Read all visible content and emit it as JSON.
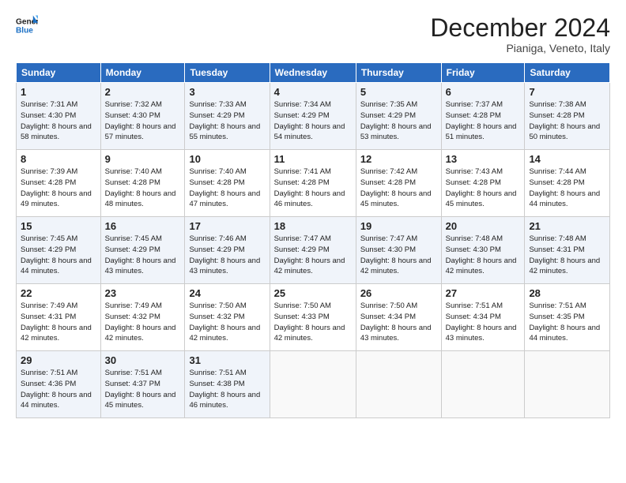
{
  "logo": {
    "line1": "General",
    "line2": "Blue"
  },
  "header": {
    "month": "December 2024",
    "location": "Pianiga, Veneto, Italy"
  },
  "weekdays": [
    "Sunday",
    "Monday",
    "Tuesday",
    "Wednesday",
    "Thursday",
    "Friday",
    "Saturday"
  ],
  "weeks": [
    [
      {
        "day": "1",
        "rise": "7:31 AM",
        "set": "4:30 PM",
        "daylight": "8 hours and 58 minutes."
      },
      {
        "day": "2",
        "rise": "7:32 AM",
        "set": "4:30 PM",
        "daylight": "8 hours and 57 minutes."
      },
      {
        "day": "3",
        "rise": "7:33 AM",
        "set": "4:29 PM",
        "daylight": "8 hours and 55 minutes."
      },
      {
        "day": "4",
        "rise": "7:34 AM",
        "set": "4:29 PM",
        "daylight": "8 hours and 54 minutes."
      },
      {
        "day": "5",
        "rise": "7:35 AM",
        "set": "4:29 PM",
        "daylight": "8 hours and 53 minutes."
      },
      {
        "day": "6",
        "rise": "7:37 AM",
        "set": "4:28 PM",
        "daylight": "8 hours and 51 minutes."
      },
      {
        "day": "7",
        "rise": "7:38 AM",
        "set": "4:28 PM",
        "daylight": "8 hours and 50 minutes."
      }
    ],
    [
      {
        "day": "8",
        "rise": "7:39 AM",
        "set": "4:28 PM",
        "daylight": "8 hours and 49 minutes."
      },
      {
        "day": "9",
        "rise": "7:40 AM",
        "set": "4:28 PM",
        "daylight": "8 hours and 48 minutes."
      },
      {
        "day": "10",
        "rise": "7:40 AM",
        "set": "4:28 PM",
        "daylight": "8 hours and 47 minutes."
      },
      {
        "day": "11",
        "rise": "7:41 AM",
        "set": "4:28 PM",
        "daylight": "8 hours and 46 minutes."
      },
      {
        "day": "12",
        "rise": "7:42 AM",
        "set": "4:28 PM",
        "daylight": "8 hours and 45 minutes."
      },
      {
        "day": "13",
        "rise": "7:43 AM",
        "set": "4:28 PM",
        "daylight": "8 hours and 45 minutes."
      },
      {
        "day": "14",
        "rise": "7:44 AM",
        "set": "4:28 PM",
        "daylight": "8 hours and 44 minutes."
      }
    ],
    [
      {
        "day": "15",
        "rise": "7:45 AM",
        "set": "4:29 PM",
        "daylight": "8 hours and 44 minutes."
      },
      {
        "day": "16",
        "rise": "7:45 AM",
        "set": "4:29 PM",
        "daylight": "8 hours and 43 minutes."
      },
      {
        "day": "17",
        "rise": "7:46 AM",
        "set": "4:29 PM",
        "daylight": "8 hours and 43 minutes."
      },
      {
        "day": "18",
        "rise": "7:47 AM",
        "set": "4:29 PM",
        "daylight": "8 hours and 42 minutes."
      },
      {
        "day": "19",
        "rise": "7:47 AM",
        "set": "4:30 PM",
        "daylight": "8 hours and 42 minutes."
      },
      {
        "day": "20",
        "rise": "7:48 AM",
        "set": "4:30 PM",
        "daylight": "8 hours and 42 minutes."
      },
      {
        "day": "21",
        "rise": "7:48 AM",
        "set": "4:31 PM",
        "daylight": "8 hours and 42 minutes."
      }
    ],
    [
      {
        "day": "22",
        "rise": "7:49 AM",
        "set": "4:31 PM",
        "daylight": "8 hours and 42 minutes."
      },
      {
        "day": "23",
        "rise": "7:49 AM",
        "set": "4:32 PM",
        "daylight": "8 hours and 42 minutes."
      },
      {
        "day": "24",
        "rise": "7:50 AM",
        "set": "4:32 PM",
        "daylight": "8 hours and 42 minutes."
      },
      {
        "day": "25",
        "rise": "7:50 AM",
        "set": "4:33 PM",
        "daylight": "8 hours and 42 minutes."
      },
      {
        "day": "26",
        "rise": "7:50 AM",
        "set": "4:34 PM",
        "daylight": "8 hours and 43 minutes."
      },
      {
        "day": "27",
        "rise": "7:51 AM",
        "set": "4:34 PM",
        "daylight": "8 hours and 43 minutes."
      },
      {
        "day": "28",
        "rise": "7:51 AM",
        "set": "4:35 PM",
        "daylight": "8 hours and 44 minutes."
      }
    ],
    [
      {
        "day": "29",
        "rise": "7:51 AM",
        "set": "4:36 PM",
        "daylight": "8 hours and 44 minutes."
      },
      {
        "day": "30",
        "rise": "7:51 AM",
        "set": "4:37 PM",
        "daylight": "8 hours and 45 minutes."
      },
      {
        "day": "31",
        "rise": "7:51 AM",
        "set": "4:38 PM",
        "daylight": "8 hours and 46 minutes."
      },
      null,
      null,
      null,
      null
    ]
  ],
  "labels": {
    "sunrise": "Sunrise:",
    "sunset": "Sunset:",
    "daylight": "Daylight:"
  }
}
